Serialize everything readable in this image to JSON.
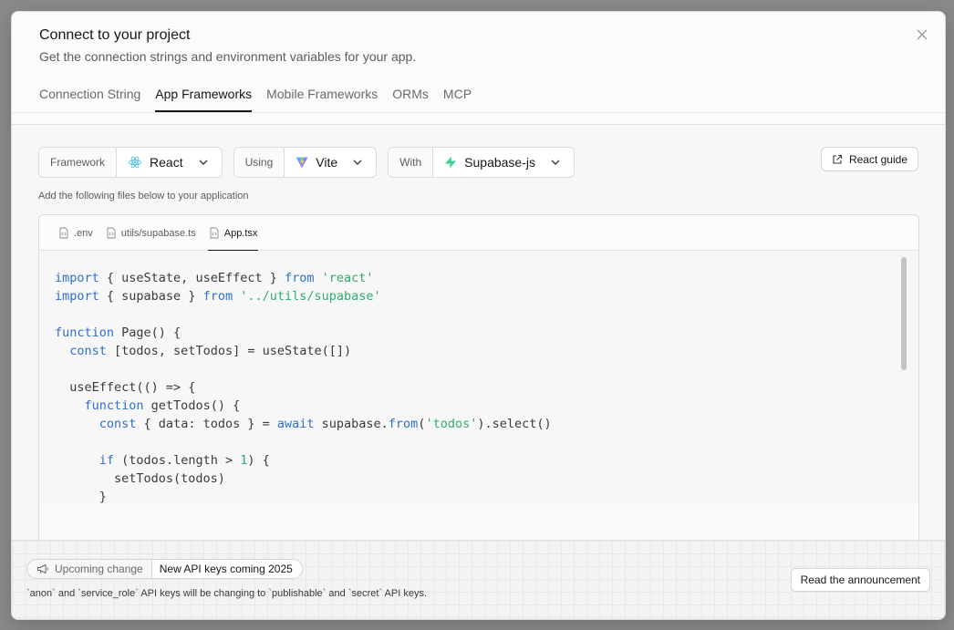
{
  "modal": {
    "title": "Connect to your project",
    "subtitle": "Get the connection strings and environment variables for your app."
  },
  "tabs": [
    {
      "label": "Connection String",
      "active": false
    },
    {
      "label": "App Frameworks",
      "active": true
    },
    {
      "label": "Mobile Frameworks",
      "active": false
    },
    {
      "label": "ORMs",
      "active": false
    },
    {
      "label": "MCP",
      "active": false
    }
  ],
  "selectors": {
    "framework": {
      "label": "Framework",
      "value": "React",
      "icon": "react-icon"
    },
    "using": {
      "label": "Using",
      "value": "Vite",
      "icon": "vite-icon"
    },
    "with": {
      "label": "With",
      "value": "Supabase-js",
      "icon": "supabase-icon"
    }
  },
  "guide_button": {
    "label": "React guide",
    "icon": "external-link-icon"
  },
  "instructions": "Add the following files below to your application",
  "file_tabs": [
    {
      "label": ".env",
      "active": false
    },
    {
      "label": "utils/supabase.ts",
      "active": false
    },
    {
      "label": "App.tsx",
      "active": true
    }
  ],
  "code_lines": [
    "import { useState, useEffect } from 'react'",
    "import { supabase } from '../utils/supabase'",
    "",
    "function Page() {",
    "  const [todos, setTodos] = useState([])",
    "",
    "  useEffect(() => {",
    "    function getTodos() {",
    "      const { data: todos } = await supabase.from('todos').select()",
    "",
    "      if (todos.length > 1) {",
    "        setTodos(todos)",
    "      }"
  ],
  "notice": {
    "pill_label": "Upcoming change",
    "pill_value": "New API keys coming 2025",
    "text": "`anon` and `service_role` API keys will be changing to `publishable` and `secret` API keys.",
    "button_label": "Read the announcement",
    "icon": "megaphone-icon"
  },
  "colors": {
    "keyword": "#2f6fd1",
    "string": "#2fae6b",
    "react": "#58c4dc",
    "supabase": "#3ecf8e"
  }
}
